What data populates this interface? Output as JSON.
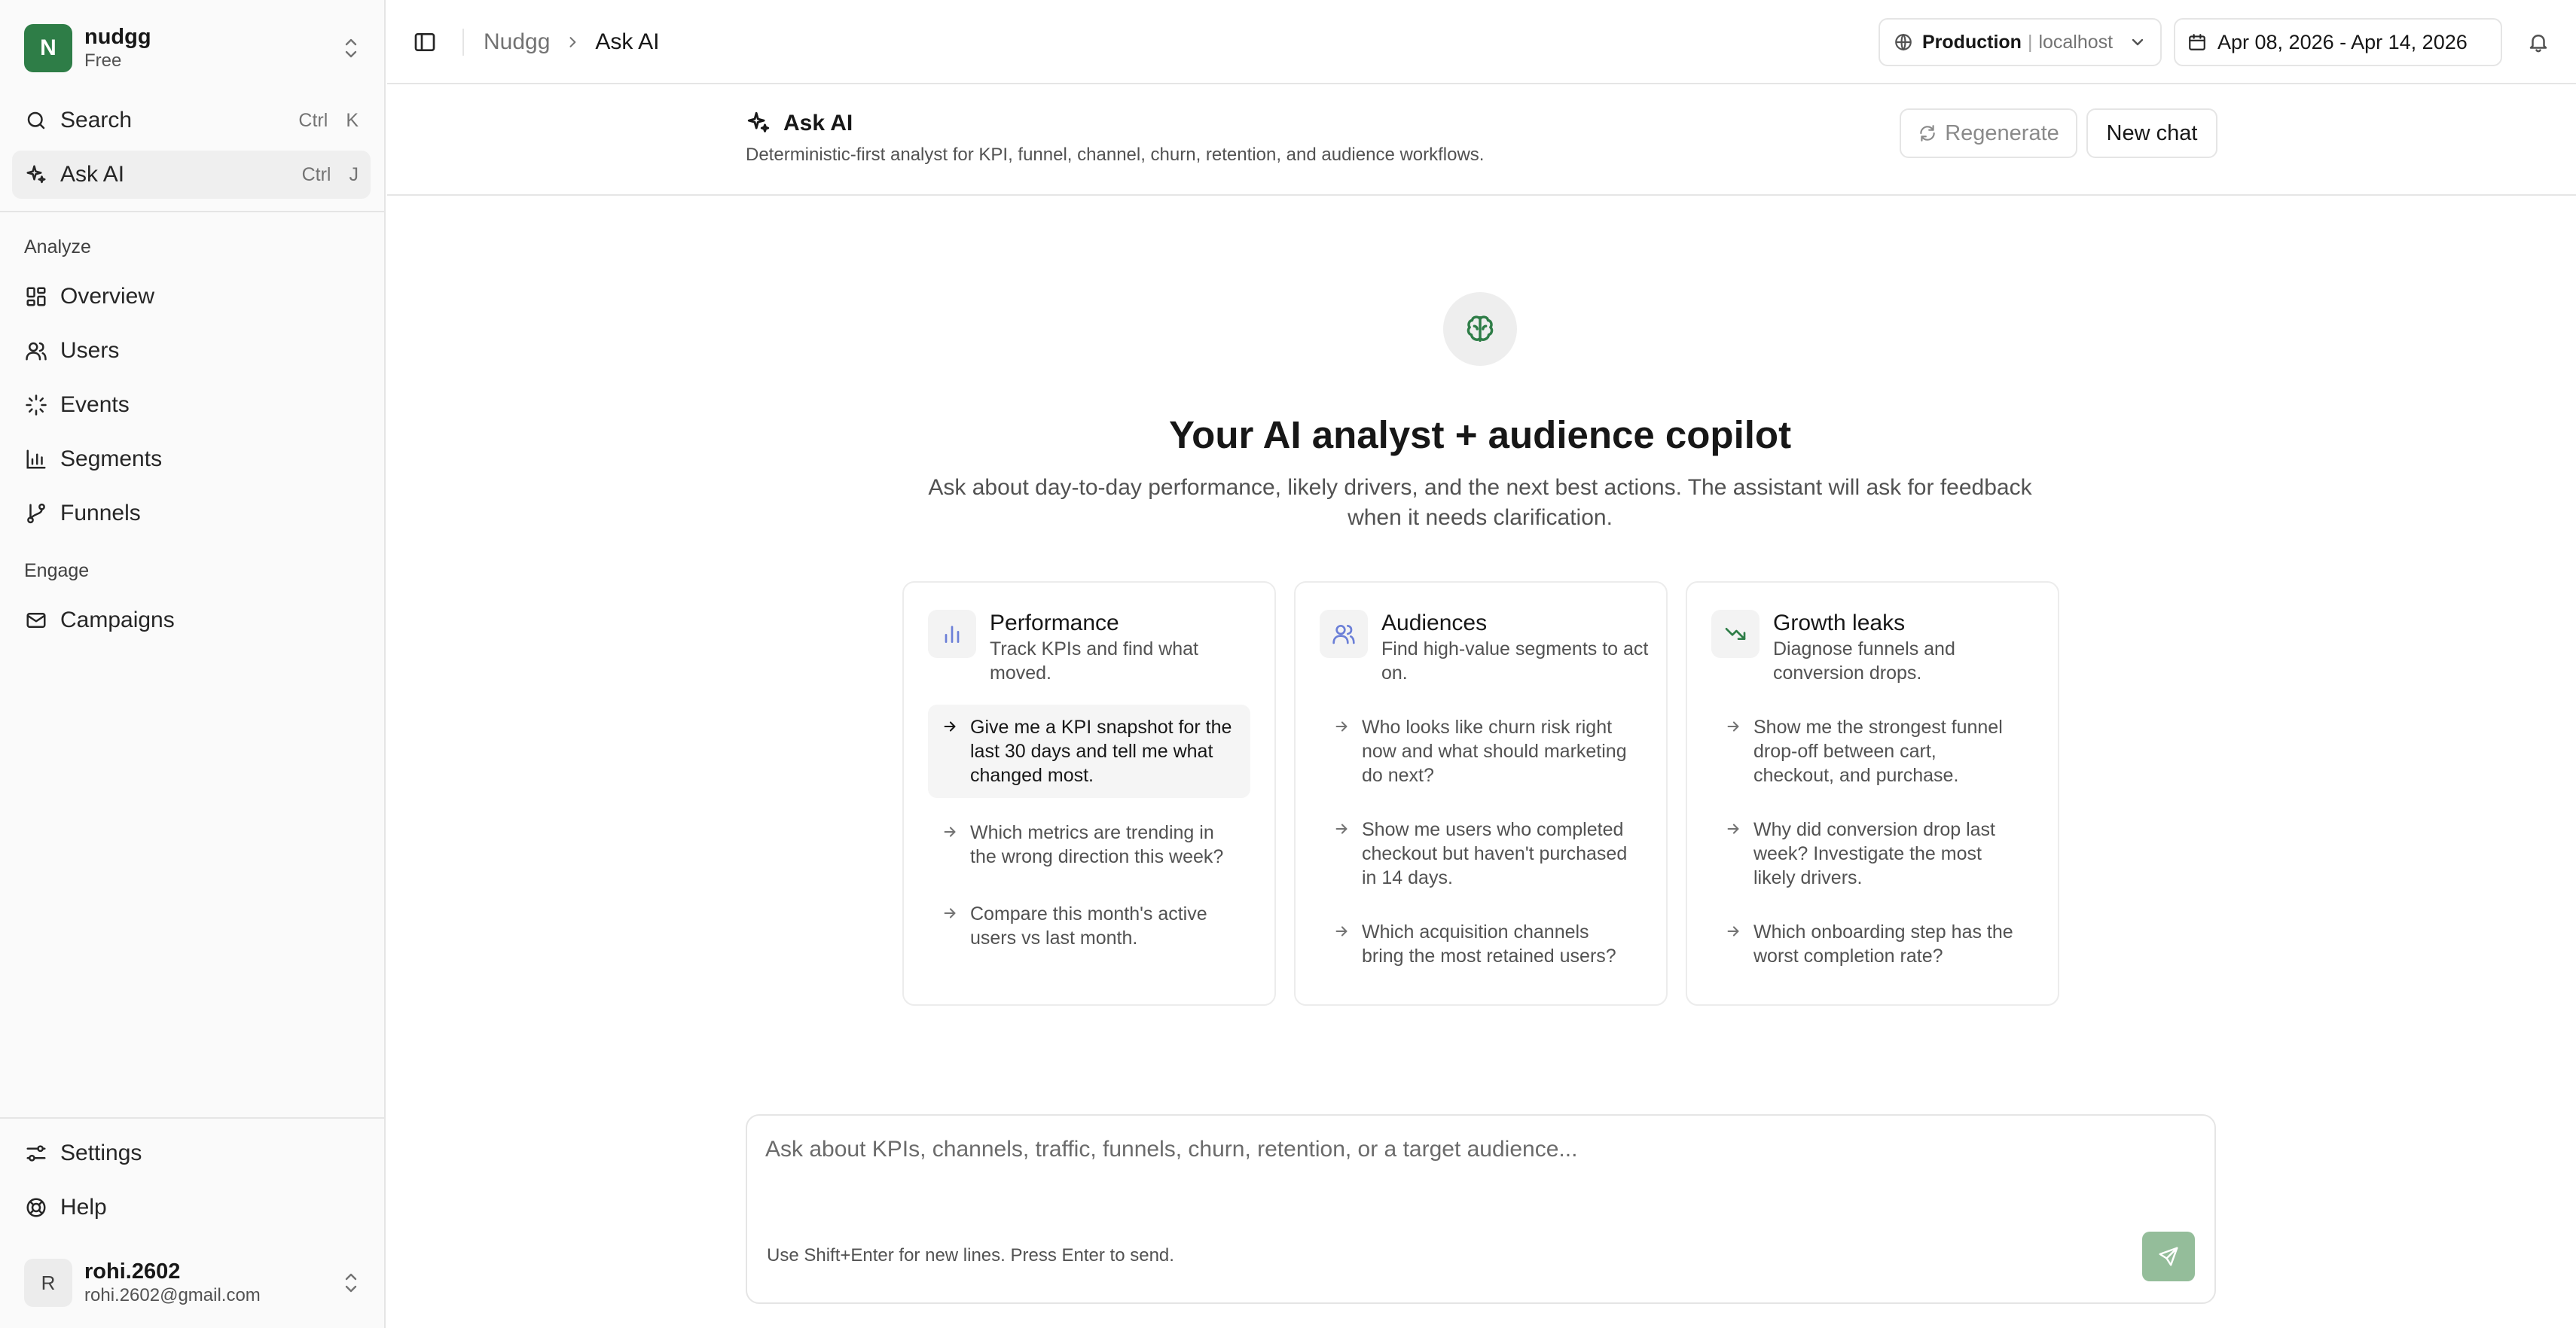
{
  "workspace": {
    "initial": "N",
    "name": "nudgg",
    "plan": "Free"
  },
  "sidebar": {
    "search": {
      "label": "Search",
      "kbd": [
        "Ctrl",
        "K"
      ]
    },
    "ask_ai": {
      "label": "Ask AI",
      "kbd": [
        "Ctrl",
        "J"
      ]
    },
    "analyze_label": "Analyze",
    "analyze_items": [
      "Overview",
      "Users",
      "Events",
      "Segments",
      "Funnels"
    ],
    "engage_label": "Engage",
    "engage_items": [
      "Campaigns"
    ],
    "settings": "Settings",
    "help": "Help"
  },
  "user": {
    "initial": "R",
    "name": "rohi.2602",
    "email": "rohi.2602@gmail.com"
  },
  "topbar": {
    "breadcrumb": [
      "Nudgg",
      "Ask AI"
    ],
    "env": {
      "name": "Production",
      "separator": "|",
      "host": "localhost"
    },
    "date_range": "Apr 08, 2026 - Apr 14, 2026"
  },
  "page": {
    "title": "Ask AI",
    "subtitle": "Deterministic-first analyst for KPI, funnel, channel, churn, retention, and audience workflows.",
    "regenerate": "Regenerate",
    "new_chat": "New chat"
  },
  "hero": {
    "title": "Your AI analyst + audience copilot",
    "subtitle": "Ask about day-to-day performance, likely drivers, and the next best actions. The assistant will ask for feedback when it needs clarification."
  },
  "cards": [
    {
      "icon": "bar-chart-icon",
      "title": "Performance",
      "desc": "Track KPIs and find what moved.",
      "prompts": [
        "Give me a KPI snapshot for the last 30 days and tell me what changed most.",
        "Which metrics are trending in the wrong direction this week?",
        "Compare this month's active users vs last month."
      ]
    },
    {
      "icon": "users-icon",
      "title": "Audiences",
      "desc": "Find high-value segments to act on.",
      "prompts": [
        "Who looks like churn risk right now and what should marketing do next?",
        "Show me users who completed checkout but haven't purchased in 14 days.",
        "Which acquisition channels bring the most retained users?"
      ]
    },
    {
      "icon": "trending-down-icon",
      "title": "Growth leaks",
      "desc": "Diagnose funnels and conversion drops.",
      "prompts": [
        "Show me the strongest funnel drop-off between cart, checkout, and purchase.",
        "Why did conversion drop last week? Investigate the most likely drivers.",
        "Which onboarding step has the worst completion rate?"
      ]
    }
  ],
  "composer": {
    "placeholder": "Ask about KPIs, channels, traffic, funnels, churn, retention, or a target audience...",
    "hint": "Use Shift+Enter for new lines. Press Enter to send."
  },
  "colors": {
    "brand": "#2e7d47",
    "send_button": "#94bd9a",
    "hero_icon": "#2e7d47",
    "card_icon_1": "#6b7fd7",
    "card_icon_2": "#6b7fd7",
    "card_icon_3": "#2e7d47"
  }
}
